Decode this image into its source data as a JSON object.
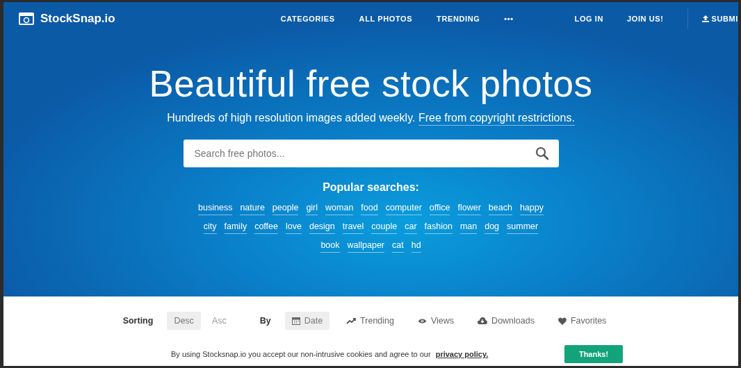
{
  "logo": {
    "text": "StockSnap.io"
  },
  "nav": [
    {
      "label": "CATEGORIES"
    },
    {
      "label": "ALL PHOTOS"
    },
    {
      "label": "TRENDING"
    },
    {
      "label": "•••"
    }
  ],
  "nav_right": [
    {
      "label": "LOG IN",
      "kind": "link"
    },
    {
      "label": "JOIN US!",
      "kind": "link"
    },
    {
      "label": "SUBMI",
      "kind": "upload"
    }
  ],
  "hero": {
    "title": "Beautiful free stock photos",
    "subtitle": "Hundreds of high resolution images added weekly.",
    "subtitle_link": "Free from copyright restrictions."
  },
  "search": {
    "placeholder": "Search free photos..."
  },
  "popular": {
    "heading": "Popular searches:",
    "tags": [
      "business",
      "nature",
      "people",
      "girl",
      "woman",
      "food",
      "computer",
      "office",
      "flower",
      "beach",
      "happy",
      "city",
      "family",
      "coffee",
      "love",
      "design",
      "travel",
      "couple",
      "car",
      "fashion",
      "man",
      "dog",
      "summer",
      "book",
      "wallpaper",
      "cat",
      "hd"
    ]
  },
  "sorting": {
    "label": "Sorting",
    "orders": [
      {
        "label": "Desc",
        "selected": true
      },
      {
        "label": "Asc",
        "selected": false
      }
    ],
    "by_label": "By",
    "by": [
      {
        "label": "Date",
        "kind": "calendar",
        "selected": true
      },
      {
        "label": "Trending",
        "kind": "trend",
        "selected": false
      },
      {
        "label": "Views",
        "kind": "eye",
        "selected": false
      },
      {
        "label": "Downloads",
        "kind": "cloud",
        "selected": false
      },
      {
        "label": "Favorites",
        "kind": "heart",
        "selected": false
      }
    ]
  },
  "cookie": {
    "text": "By using Stocksnap.io you accept our non-intrusive cookies and agree to our",
    "link": "privacy policy.",
    "button": "Thanks!"
  }
}
